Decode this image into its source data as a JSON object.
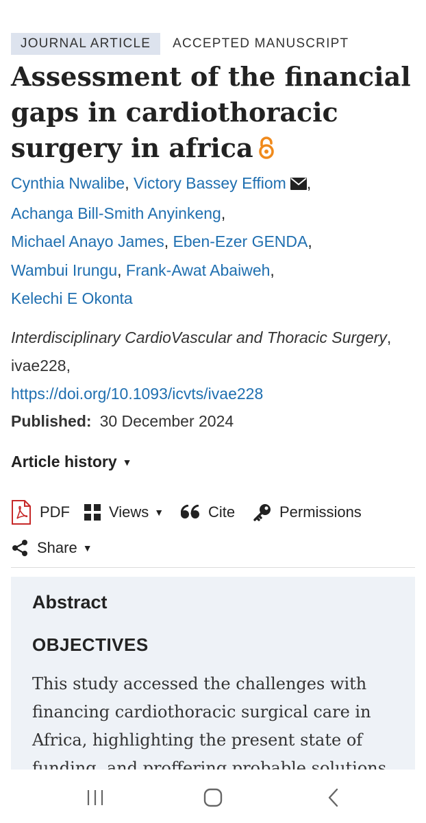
{
  "badges": {
    "type": "JOURNAL ARTICLE",
    "status": "ACCEPTED MANUSCRIPT"
  },
  "article": {
    "title": "Assessment of the financial gaps in cardiothoracic surgery in africa"
  },
  "authors": [
    "Cynthia Nwalibe",
    "Victory Bassey Effiom",
    "Achanga Bill-Smith Anyinkeng",
    "Michael Anayo James",
    "Eben-Ezer GENDA",
    "Wambui Irungu",
    "Frank-Awat Abaiweh",
    "Kelechi E Okonta"
  ],
  "citation": {
    "journal": "Interdisciplinary CardioVascular and Thoracic Surgery",
    "article_id": ", ivae228,",
    "doi": "https://doi.org/10.1093/icvts/ivae228"
  },
  "published": {
    "label": "Published:",
    "date": "30 December 2024"
  },
  "article_history": {
    "label": "Article history"
  },
  "toolbar": {
    "pdf": "PDF",
    "views": "Views",
    "cite": "Cite",
    "permissions": "Permissions",
    "share": "Share"
  },
  "abstract": {
    "heading": "Abstract",
    "section": "OBJECTIVES",
    "text": "This study accessed the challenges with financing cardiothoracic surgical care in Africa, highlighting the present state of funding, and proffering probable solutions"
  },
  "colors": {
    "link": "#1f6fb0",
    "badge_bg": "#dde3ee",
    "abstract_bg": "#eef2f7",
    "oa_orange": "#f08a1c",
    "pdf_red": "#c62828"
  },
  "icons": {
    "open_access": "open-access-lock-icon",
    "email": "envelope-icon",
    "pdf": "pdf-icon",
    "views": "grid-icon",
    "cite": "quote-icon",
    "permissions": "key-icon",
    "share": "share-icon"
  }
}
